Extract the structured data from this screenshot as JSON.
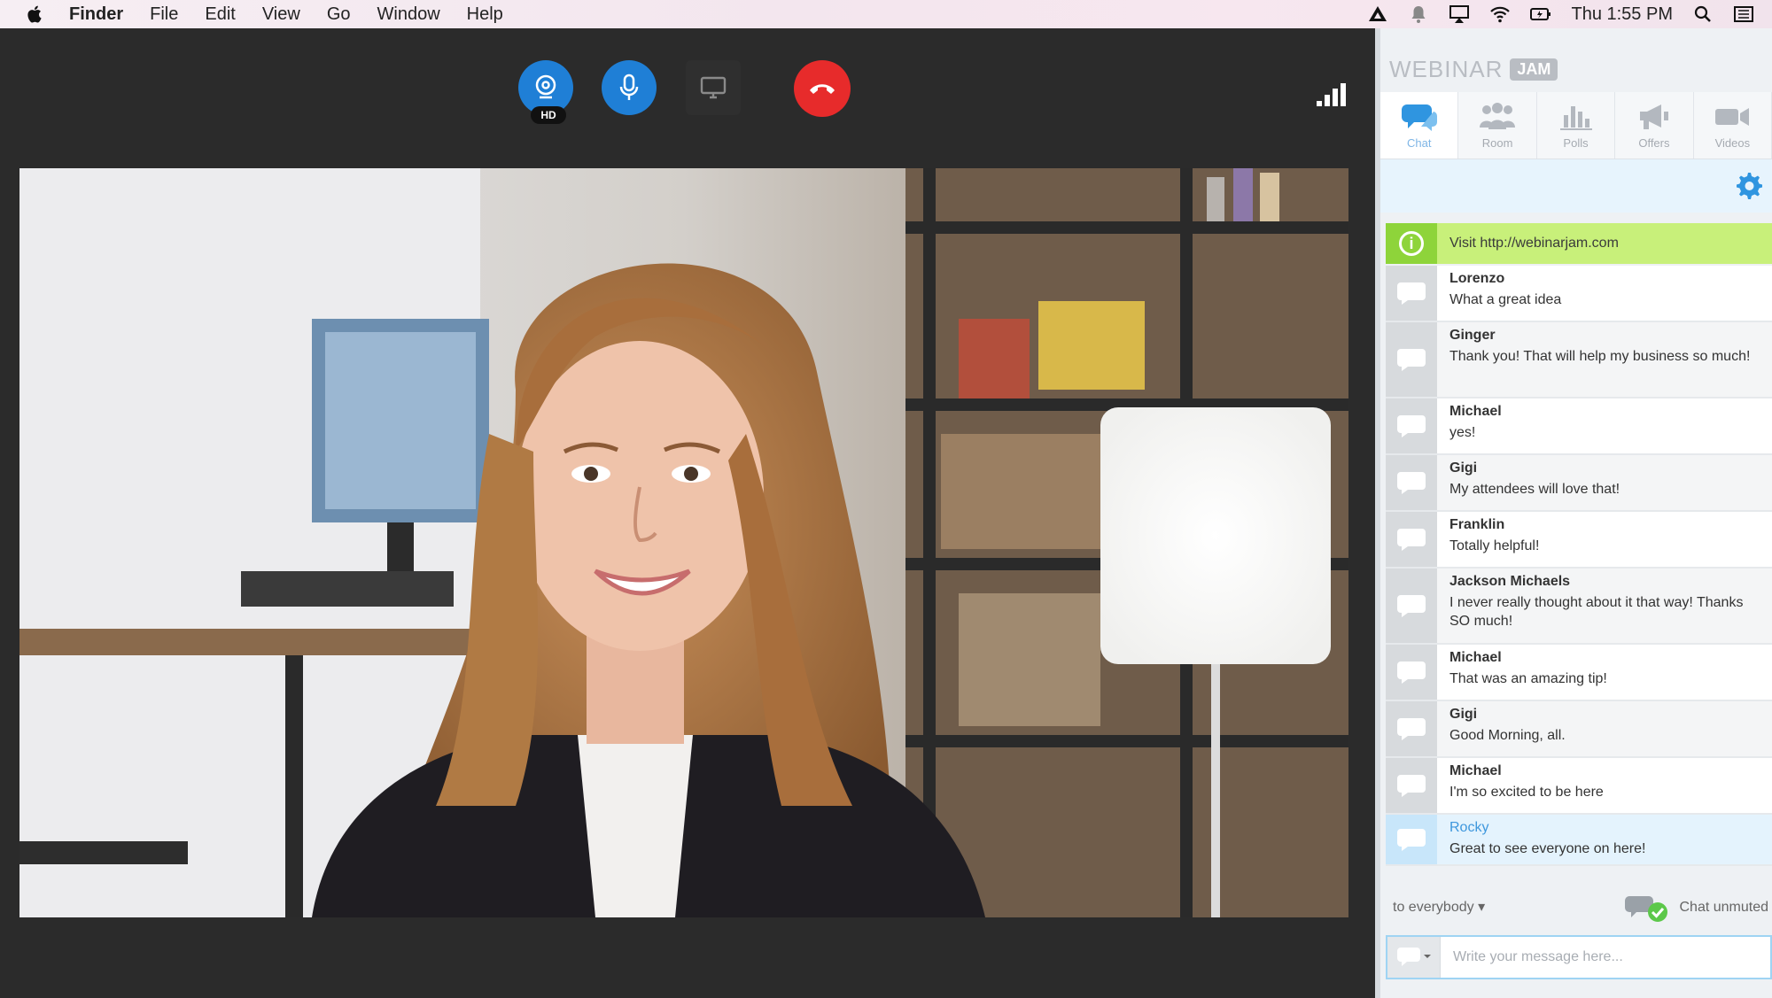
{
  "menubar": {
    "items": [
      "Finder",
      "File",
      "Edit",
      "View",
      "Go",
      "Window",
      "Help"
    ],
    "clock": "Thu 1:55 PM"
  },
  "toolbar": {
    "hd_label": "HD"
  },
  "brand": {
    "word": "WEBINAR",
    "badge": "JAM"
  },
  "tabs": [
    {
      "label": "Chat",
      "icon": "chat-icon"
    },
    {
      "label": "Room",
      "icon": "room-icon"
    },
    {
      "label": "Polls",
      "icon": "polls-icon"
    },
    {
      "label": "Offers",
      "icon": "offers-icon"
    },
    {
      "label": "Videos",
      "icon": "videos-icon"
    }
  ],
  "notice": {
    "text": "Visit http://webinarjam.com"
  },
  "messages": [
    {
      "name": "Lorenzo",
      "text": "What a great idea"
    },
    {
      "name": "Ginger",
      "text": "Thank you! That will help my business so much!"
    },
    {
      "name": "Michael",
      "text": "yes!"
    },
    {
      "name": "Gigi",
      "text": "My attendees will love that!"
    },
    {
      "name": "Franklin",
      "text": "Totally helpful!"
    },
    {
      "name": "Jackson Michaels",
      "text": "I never really thought about it that way! Thanks SO much!"
    },
    {
      "name": "Michael",
      "text": "That was an amazing tip!"
    },
    {
      "name": "Gigi",
      "text": "Good Morning, all."
    },
    {
      "name": "Michael",
      "text": "I'm so excited to be here"
    },
    {
      "name": "Rocky",
      "text": "Great to see everyone on here!"
    }
  ],
  "footer": {
    "recipient": "to everybody",
    "status": "Chat unmuted",
    "placeholder": "Write your message here..."
  },
  "colors": {
    "accent_blue": "#1f7fd6",
    "hangup_red": "#e72b2b",
    "notice_green": "#c8f07a"
  }
}
